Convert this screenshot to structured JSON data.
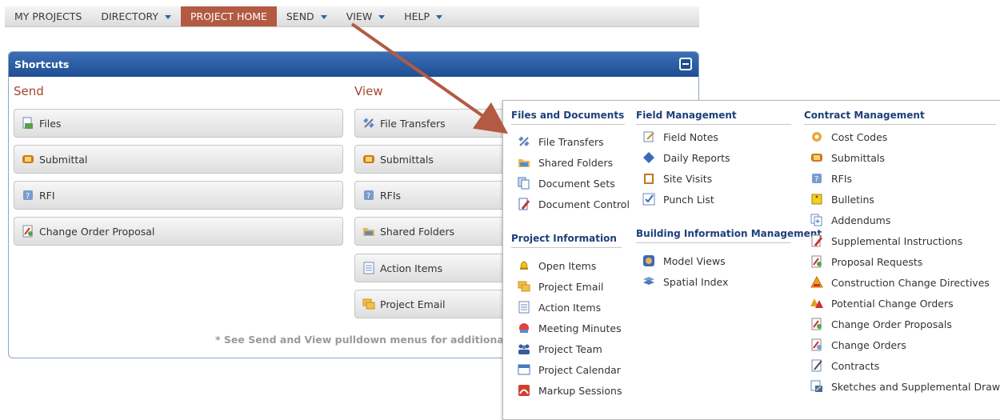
{
  "nav": {
    "items": [
      {
        "label": "MY PROJECTS",
        "caret": false,
        "active": false
      },
      {
        "label": "DIRECTORY",
        "caret": true,
        "active": false
      },
      {
        "label": "PROJECT HOME",
        "caret": false,
        "active": true
      },
      {
        "label": "SEND",
        "caret": true,
        "active": false
      },
      {
        "label": "VIEW",
        "caret": true,
        "active": false
      },
      {
        "label": "HELP",
        "caret": true,
        "active": false
      }
    ]
  },
  "shortcuts": {
    "title": "Shortcuts",
    "send_title": "Send",
    "view_title": "View",
    "send": [
      {
        "label": "Files",
        "icon": "files-icon"
      },
      {
        "label": "Submittal",
        "icon": "submittal-icon"
      },
      {
        "label": "RFI",
        "icon": "rfi-icon"
      },
      {
        "label": "Change Order Proposal",
        "icon": "change-order-icon"
      }
    ],
    "view": [
      {
        "label": "File Transfers",
        "icon": "satellite-icon"
      },
      {
        "label": "Submittals",
        "icon": "submittal-icon"
      },
      {
        "label": "RFIs",
        "icon": "rfi-icon"
      },
      {
        "label": "Shared Folders",
        "icon": "folder-icon"
      },
      {
        "label": "Action Items",
        "icon": "list-icon"
      },
      {
        "label": "Project Email",
        "icon": "email-icon"
      }
    ],
    "note": "* See Send and View pulldown menus for additional tasks"
  },
  "menu": {
    "files_docs": {
      "title": "Files and Documents",
      "items": [
        {
          "label": "File Transfers",
          "icon": "satellite-icon"
        },
        {
          "label": "Shared Folders",
          "icon": "folder-icon"
        },
        {
          "label": "Document Sets",
          "icon": "document-sets-icon"
        },
        {
          "label": "Document Control",
          "icon": "document-control-icon"
        }
      ]
    },
    "project_info": {
      "title": "Project Information",
      "items": [
        {
          "label": "Open Items",
          "icon": "bell-icon"
        },
        {
          "label": "Project Email",
          "icon": "email-icon"
        },
        {
          "label": "Action Items",
          "icon": "list-icon"
        },
        {
          "label": "Meeting Minutes",
          "icon": "meeting-icon"
        },
        {
          "label": "Project Team",
          "icon": "team-icon"
        },
        {
          "label": "Project Calendar",
          "icon": "calendar-icon"
        },
        {
          "label": "Markup Sessions",
          "icon": "markup-icon"
        }
      ]
    },
    "field_mgmt": {
      "title": "Field Management",
      "items": [
        {
          "label": "Field Notes",
          "icon": "notes-icon"
        },
        {
          "label": "Daily Reports",
          "icon": "diamond-icon"
        },
        {
          "label": "Site Visits",
          "icon": "clipboard-icon"
        },
        {
          "label": "Punch List",
          "icon": "checkbox-icon"
        }
      ]
    },
    "bim": {
      "title": "Building Information Management",
      "items": [
        {
          "label": "Model Views",
          "icon": "model-icon"
        },
        {
          "label": "Spatial Index",
          "icon": "layers-icon"
        }
      ]
    },
    "contract_mgmt": {
      "title": "Contract Management",
      "items": [
        {
          "label": "Cost Codes",
          "icon": "cost-codes-icon"
        },
        {
          "label": "Submittals",
          "icon": "submittal-icon"
        },
        {
          "label": "RFIs",
          "icon": "rfi-icon"
        },
        {
          "label": "Bulletins",
          "icon": "bulletin-icon"
        },
        {
          "label": "Addendums",
          "icon": "addendum-icon"
        },
        {
          "label": "Supplemental Instructions",
          "icon": "supplemental-icon"
        },
        {
          "label": "Proposal Requests",
          "icon": "change-order-icon"
        },
        {
          "label": "Construction Change Directives",
          "icon": "warning-icon"
        },
        {
          "label": "Potential Change Orders",
          "icon": "shapes-icon"
        },
        {
          "label": "Change Order Proposals",
          "icon": "change-order-icon"
        },
        {
          "label": "Change Orders",
          "icon": "change-order-icon"
        },
        {
          "label": "Contracts",
          "icon": "contract-icon"
        },
        {
          "label": "Sketches and Supplemental Drawings",
          "icon": "sketch-icon"
        }
      ]
    }
  },
  "colors": {
    "accent": "#b35a43",
    "header_blue": "#1f4e92",
    "menu_title": "#1f3f7a",
    "arrow": "#b35a43"
  }
}
